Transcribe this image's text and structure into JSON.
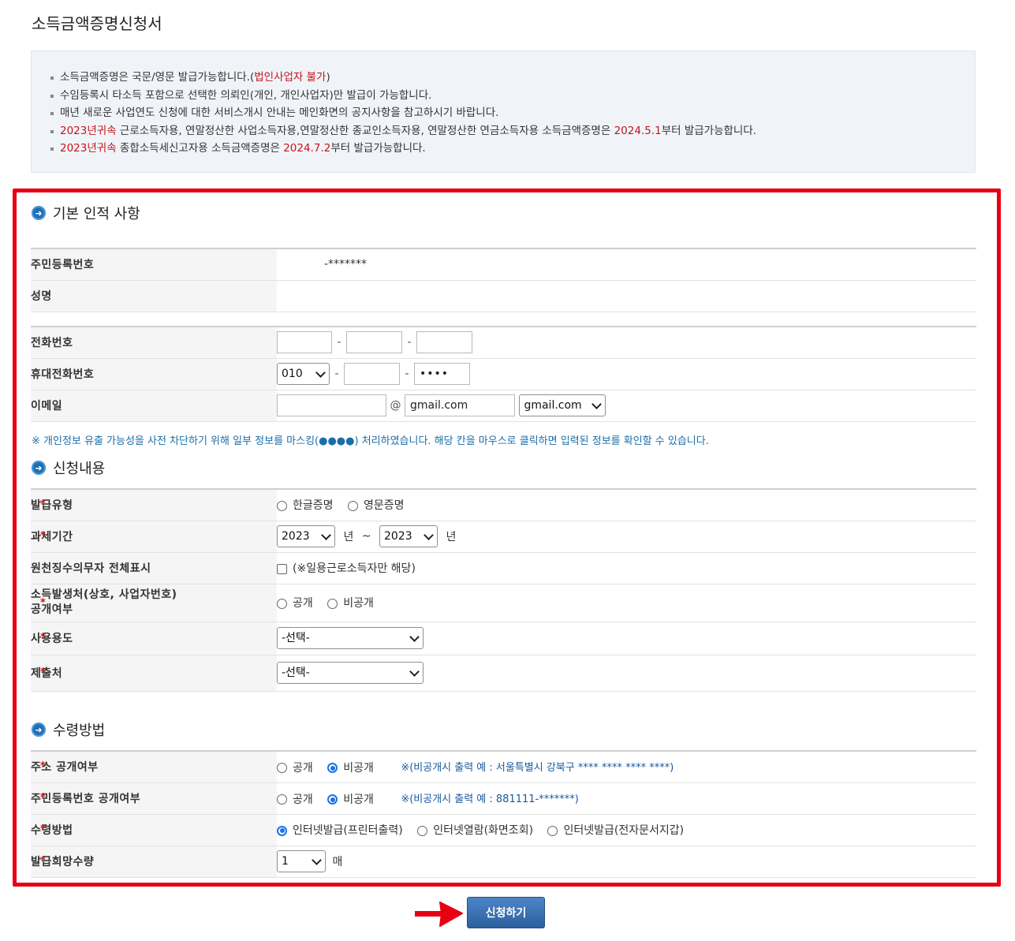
{
  "title": "소득금액증명신청서",
  "notice": {
    "l1_a": "소득금액증명은 국문/영문 발급가능합니다.(",
    "l1_red": "법인사업자 불가",
    "l1_b": ")",
    "l2": "수임등록시 타소득 포함으로 선택한 의뢰인(개인, 개인사업자)만 발급이 가능합니다.",
    "l3": "매년 새로운 사업연도 신청에 대한 서비스개시 안내는 메인화면의 공지사항을 참고하시기 바랍니다.",
    "l4_red1": "2023년귀속",
    "l4_a": " 근로소득자용, 연말정산한 사업소득자용,연말정산한 종교인소득자용, 연말정산한 연금소득자용 소득금액증명은 ",
    "l4_red2": "2024.5.1",
    "l4_b": "부터 발급가능합니다.",
    "l5_red1": "2023년귀속",
    "l5_a": " 종합소득세신고자용 소득금액증명은 ",
    "l5_red2": "2024.7.2",
    "l5_b": "부터 발급가능합니다."
  },
  "section1": {
    "title": "기본 인적 사항",
    "rrn_label": "주민등록번호",
    "rrn_value": "-*******",
    "name_label": "성명",
    "name_value": "",
    "phone_label": "전화번호",
    "phone_dash": "-",
    "mobile_label": "휴대전화번호",
    "mobile_prefix": "010",
    "mobile_last": "••••",
    "email_label": "이메일",
    "email_at": "@",
    "email_domain": "gmail.com",
    "email_select": "gmail.com"
  },
  "mask_note": "※ 개인정보 유출 가능성을 사전 차단하기 위해 일부 정보를 마스킹(●●●●) 처리하였습니다. 해당 칸을 마우스로 클릭하면 입력된 정보를 확인할 수 있습니다.",
  "section2": {
    "title": "신청내용",
    "type_label": "발급유형",
    "type_opt1": "한글증명",
    "type_opt2": "영문증명",
    "period_label": "과세기간",
    "period_from": "2023",
    "period_to": "2023",
    "year_unit": "년",
    "tilde": "~",
    "withholder_label": "원천징수의무자 전체표시",
    "withholder_note": "(※일용근로소득자만 해당)",
    "source_label1": "소득발생처(상호, 사업자번호)",
    "source_label2": "공개여부",
    "public": "공개",
    "private": "비공개",
    "usage_label": "사용용도",
    "usage_value": "-선택-",
    "submit_to_label": "제출처",
    "submit_to_value": "-선택-"
  },
  "section3": {
    "title": "수령방법",
    "addr_label": "주소 공개여부",
    "public": "공개",
    "private": "비공개",
    "addr_hint": "※(비공개시 출력 예 : 서울특별시 강북구 **** **** **** ****)",
    "rrn_label": "주민등록번호 공개여부",
    "rrn_hint": "※(비공개시 출력 예 : 881111-*******)",
    "method_label": "수령방법",
    "method_opt1": "인터넷발급(프린터출력)",
    "method_opt2": "인터넷열람(화면조회)",
    "method_opt3": "인터넷발급(전자문서지갑)",
    "qty_label": "발급희망수량",
    "qty_value": "1",
    "qty_unit": "매"
  },
  "submit_label": "신청하기",
  "colors": {
    "accent_red": "#e60012",
    "button_blue": "#2c5f9d",
    "notice_bg": "#f0f4f9"
  }
}
